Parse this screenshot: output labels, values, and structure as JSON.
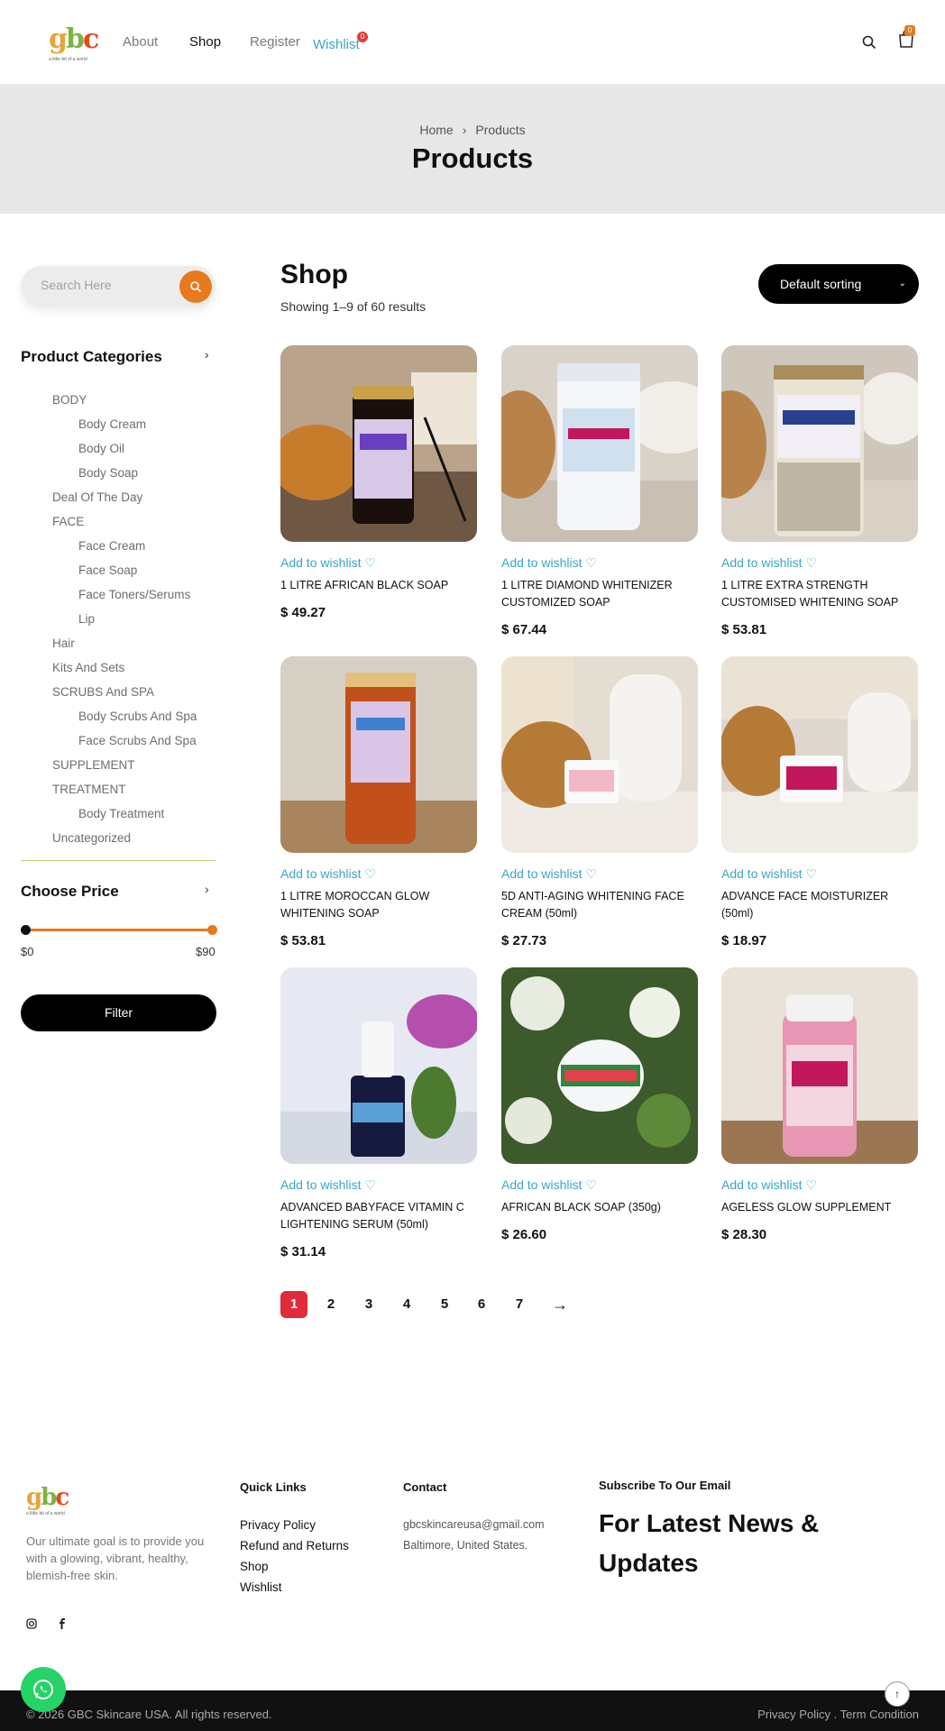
{
  "header": {
    "logo_text": "gbc",
    "logo_tagline": "a little bit of a world",
    "nav": [
      "About",
      "Shop",
      "Register",
      "Wishlist"
    ],
    "wishlist_count": "0",
    "cart_count": "0"
  },
  "banner": {
    "breadcrumb": [
      "Home",
      "Products"
    ],
    "title": "Products"
  },
  "sidebar": {
    "search_placeholder": "Search Here",
    "categories_heading": "Product Categories",
    "categories": [
      {
        "label": "BODY",
        "sub": false
      },
      {
        "label": "Body Cream",
        "sub": true
      },
      {
        "label": "Body Oil",
        "sub": true
      },
      {
        "label": "Body Soap",
        "sub": true
      },
      {
        "label": "Deal Of The Day",
        "sub": false
      },
      {
        "label": "FACE",
        "sub": false
      },
      {
        "label": "Face Cream",
        "sub": true
      },
      {
        "label": "Face Soap",
        "sub": true
      },
      {
        "label": "Face Toners/Serums",
        "sub": true
      },
      {
        "label": "Lip",
        "sub": true
      },
      {
        "label": "Hair",
        "sub": false
      },
      {
        "label": "Kits And Sets",
        "sub": false
      },
      {
        "label": "SCRUBS And SPA",
        "sub": false
      },
      {
        "label": "Body Scrubs And Spa",
        "sub": true
      },
      {
        "label": "Face Scrubs And Spa",
        "sub": true
      },
      {
        "label": "SUPPLEMENT",
        "sub": false
      },
      {
        "label": "TREATMENT",
        "sub": false
      },
      {
        "label": "Body Treatment",
        "sub": true
      },
      {
        "label": "Uncategorized",
        "sub": false
      }
    ],
    "price_heading": "Choose Price",
    "price_min": "$0",
    "price_max": "$90",
    "filter_label": "Filter"
  },
  "shop": {
    "title": "Shop",
    "result_count": "Showing 1–9 of 60 results",
    "sort_label": "Default sorting",
    "wishlist_label": "Add to wishlist",
    "products": [
      {
        "name": "1 LITRE AFRICAN BLACK SOAP",
        "price": "$ 49.27"
      },
      {
        "name": "1 LITRE DIAMOND WHITENIZER CUSTOMIZED SOAP",
        "price": "$ 67.44"
      },
      {
        "name": "1 LITRE EXTRA STRENGTH CUSTOMISED WHITENING SOAP",
        "price": "$ 53.81"
      },
      {
        "name": "1 LITRE MOROCCAN GLOW WHITENING SOAP",
        "price": "$ 53.81"
      },
      {
        "name": "5D ANTI-AGING WHITENING FACE CREAM (50ml)",
        "price": "$ 27.73"
      },
      {
        "name": "ADVANCE FACE MOISTURIZER (50ml)",
        "price": "$ 18.97"
      },
      {
        "name": "ADVANCED BABYFACE VITAMIN C LIGHTENING SERUM (50ml)",
        "price": "$ 31.14"
      },
      {
        "name": "AFRICAN BLACK SOAP (350g)",
        "price": "$ 26.60"
      },
      {
        "name": "AGELESS GLOW SUPPLEMENT",
        "price": "$ 28.30"
      }
    ],
    "pages": [
      "1",
      "2",
      "3",
      "4",
      "5",
      "6",
      "7",
      "→"
    ],
    "current_page": "1"
  },
  "footer": {
    "about": "Our ultimate goal is to provide you with a glowing, vibrant, healthy, blemish-free skin.",
    "quick_links_heading": "Quick Links",
    "quick_links": [
      "Privacy Policy",
      "Refund and Returns",
      "Shop",
      "Wishlist"
    ],
    "contact_heading": "Contact",
    "email": "gbcskincareusa@gmail.com",
    "address": "Baltimore, United States.",
    "subscribe_heading": "Subscribe To Our Email",
    "subscribe_big": "For Latest News & Updates",
    "copyright": "© 2026 GBC Skincare USA. All rights reserved.",
    "legal": "Privacy Policy . Term Condition"
  },
  "colors": {
    "accent": "#e87a1e",
    "link": "#3aa6c4",
    "pager_active": "#e02b3a"
  }
}
